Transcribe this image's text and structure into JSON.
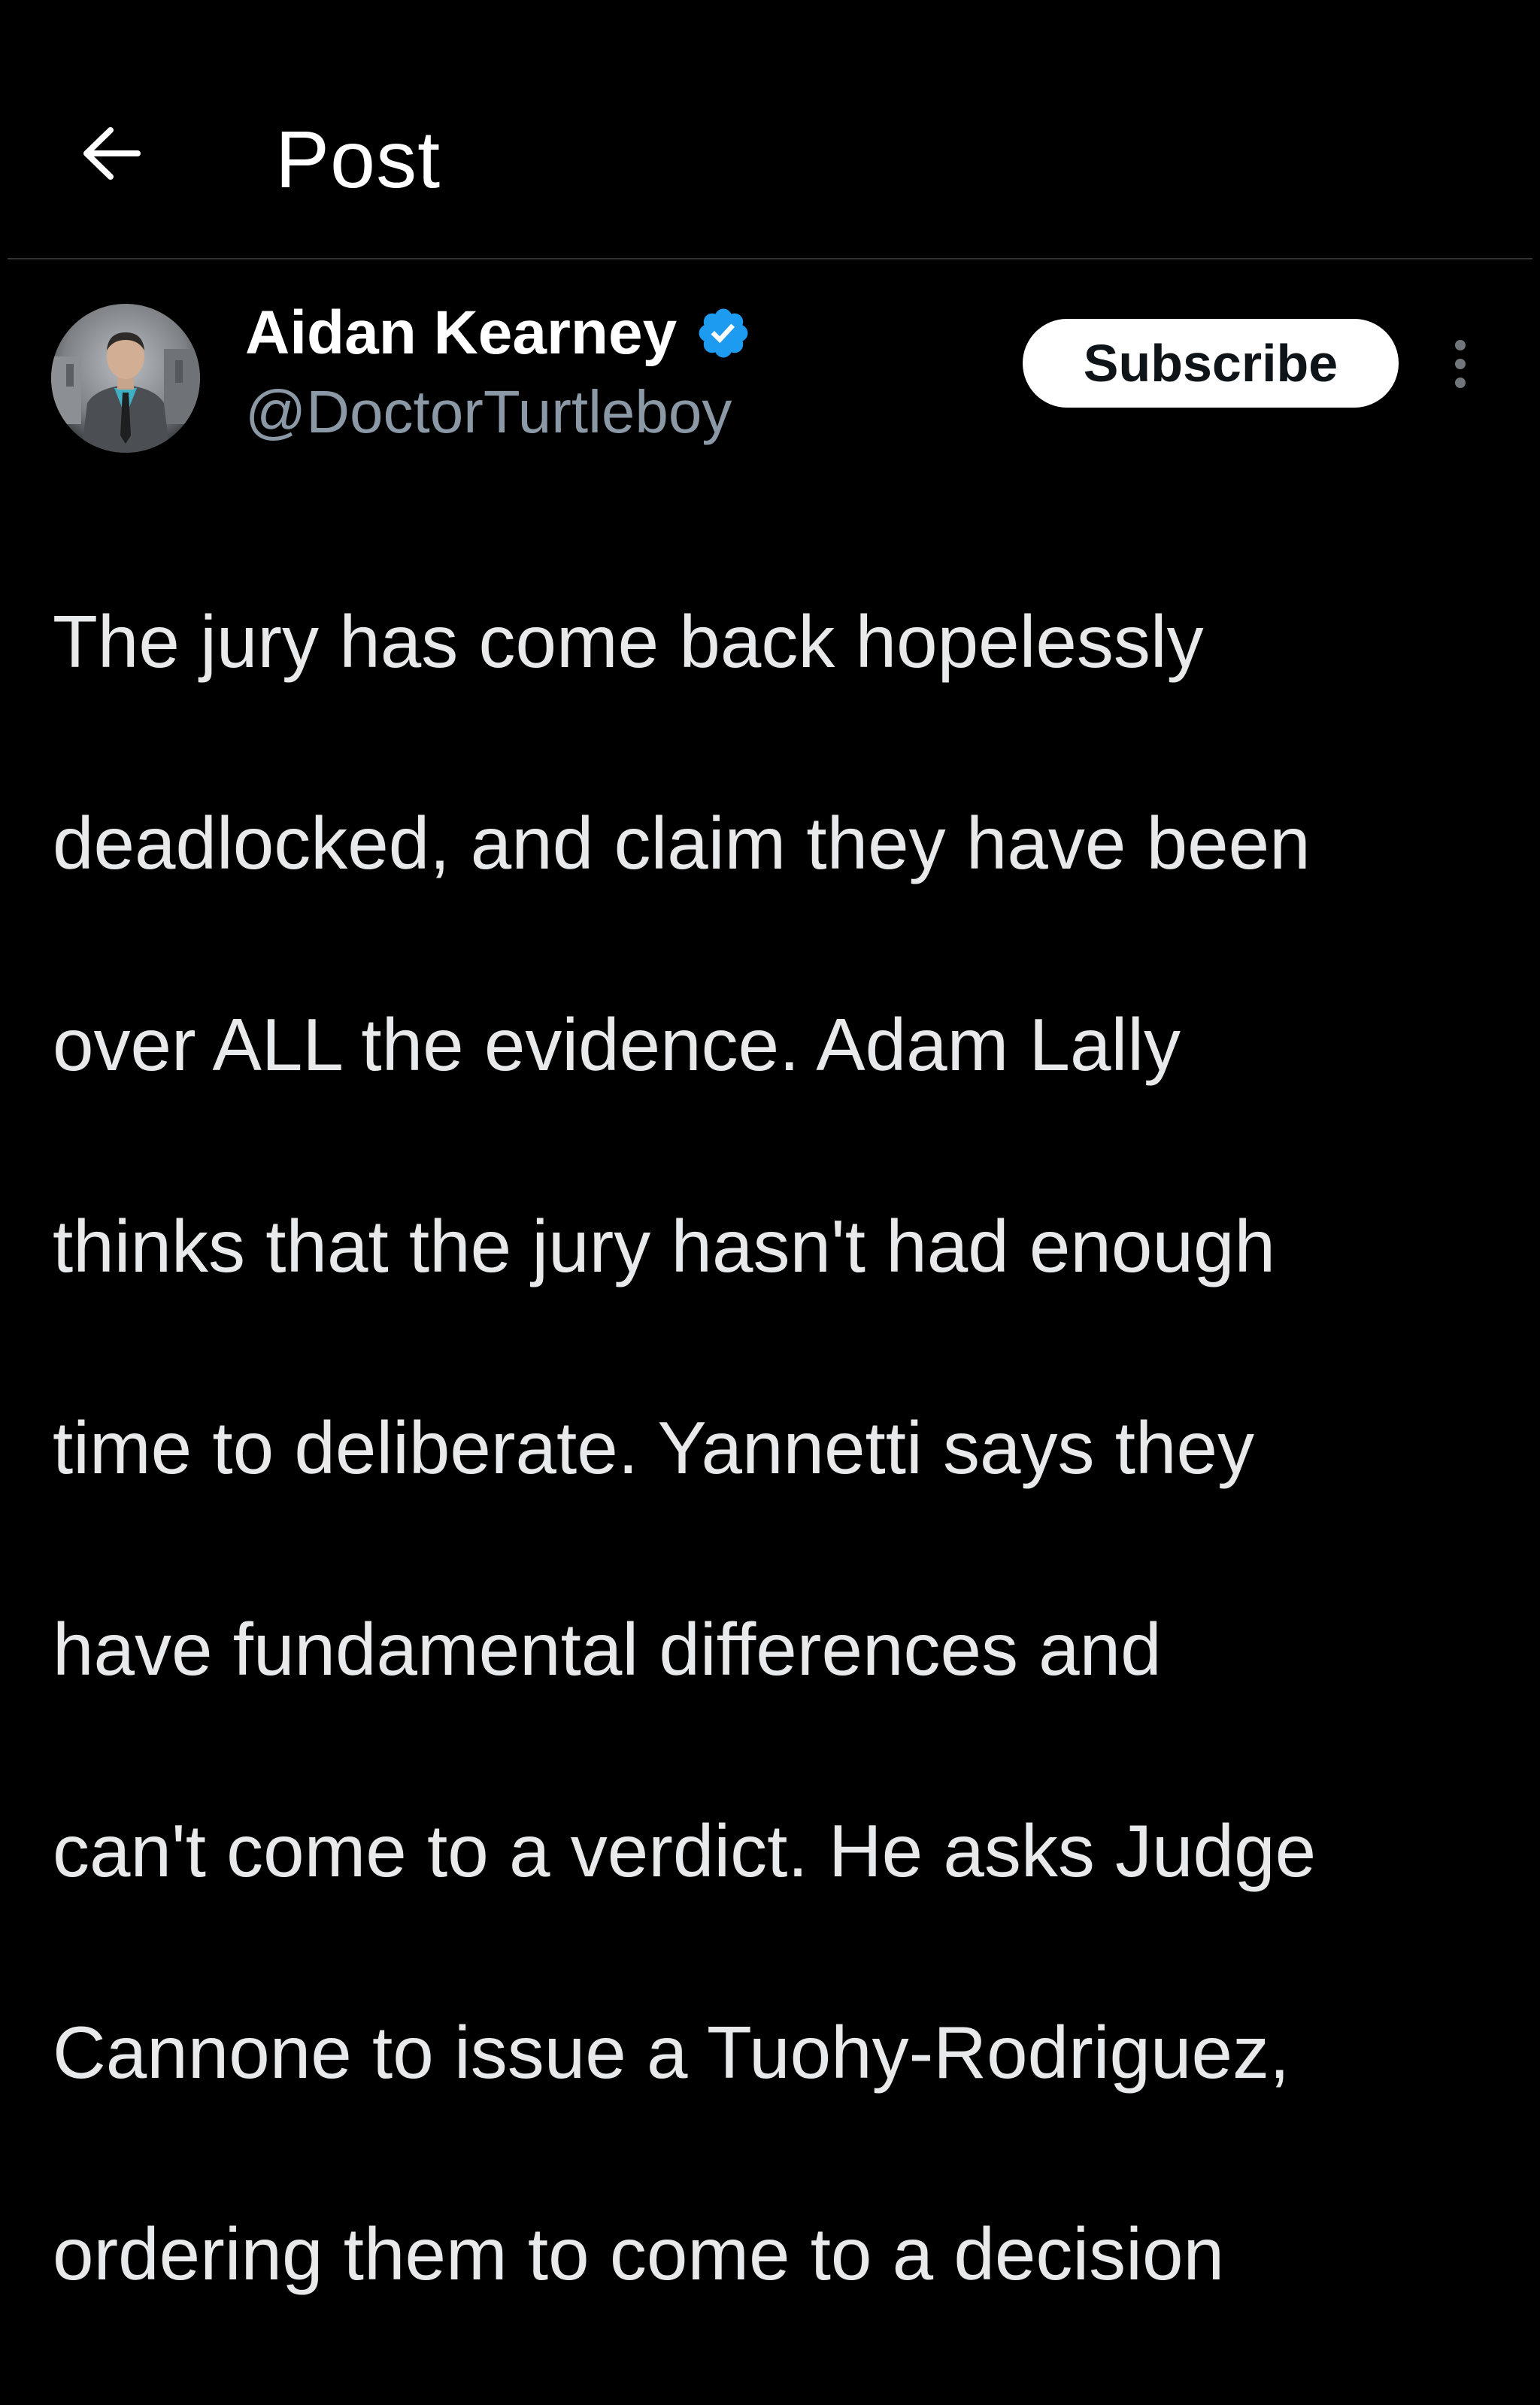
{
  "header": {
    "back_icon": "arrow-left-icon",
    "title": "Post"
  },
  "post": {
    "author": {
      "name": "Aidan Kearney",
      "handle": "@DoctorTurtleboy",
      "verified_icon": "verified-badge-icon",
      "verified_color": "#1d9bf0",
      "avatar_icon": "avatar-photo"
    },
    "subscribe_label": "Subscribe",
    "more_icon": "more-vertical-icon",
    "lines": [
      "The jury has come back hopelessly",
      "deadlocked, and claim they have been",
      "over ALL the evidence. Adam Lally",
      "thinks that the jury hasn't had enough",
      "time to deliberate. Yannetti says they",
      "have fundamental differences and",
      "can't come to a verdict. He asks Judge",
      "Cannone to issue a Tuohy-Rodriguez,",
      "ordering them to come to a decision"
    ]
  },
  "colors": {
    "background": "#000000",
    "text": "#e7e9ea",
    "secondary_text": "#8b98a5",
    "divider": "#2f3336",
    "button_bg": "#ffffff",
    "button_text": "#0f1419"
  }
}
